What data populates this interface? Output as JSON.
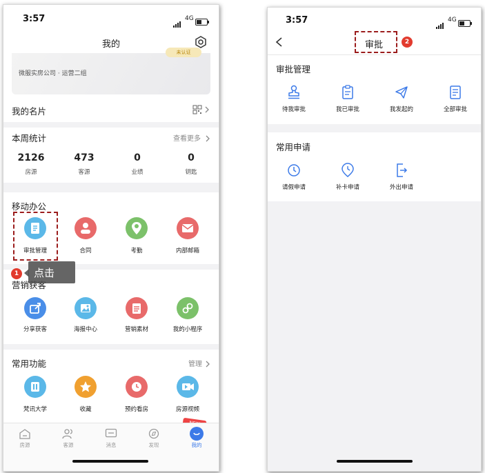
{
  "left": {
    "status": {
      "time": "3:57",
      "network": "4G"
    },
    "header": {
      "title": "我的"
    },
    "profile": {
      "badge": "未认证",
      "company": "微服实房公司 · 运营二组"
    },
    "business_card": {
      "label": "我的名片"
    },
    "weekly": {
      "title": "本周统计",
      "more": "查看更多",
      "stats": [
        {
          "value": "2126",
          "label": "房源"
        },
        {
          "value": "473",
          "label": "客源"
        },
        {
          "value": "0",
          "label": "业绩"
        },
        {
          "value": "0",
          "label": "钥匙"
        }
      ]
    },
    "mobile_office": {
      "title": "移动办公",
      "items": [
        {
          "label": "审批管理",
          "icon": "approval-doc-icon",
          "color": "#5bb8e8"
        },
        {
          "label": "合同",
          "icon": "person-contract-icon",
          "color": "#e86a6a"
        },
        {
          "label": "考勤",
          "icon": "location-pin-icon",
          "color": "#7cc16a"
        },
        {
          "label": "内部邮箱",
          "icon": "mail-icon",
          "color": "#e86a6a"
        }
      ]
    },
    "annotation": {
      "number": "1",
      "text": "点击"
    },
    "marketing": {
      "title": "营销获客",
      "items": [
        {
          "label": "分享获客",
          "icon": "share-icon",
          "color": "#4a8ee8"
        },
        {
          "label": "海报中心",
          "icon": "poster-icon",
          "color": "#5bb8e8"
        },
        {
          "label": "营销素材",
          "icon": "material-icon",
          "color": "#e86a6a"
        },
        {
          "label": "我的小程序",
          "icon": "mini-program-icon",
          "color": "#7cc16a"
        }
      ]
    },
    "common": {
      "title": "常用功能",
      "manage": "管理",
      "items": [
        {
          "label": "梵讯大学",
          "icon": "university-icon",
          "color": "#5bb8e8"
        },
        {
          "label": "收藏",
          "icon": "star-icon",
          "color": "#f0a030"
        },
        {
          "label": "预约看房",
          "icon": "clock-icon",
          "color": "#e86a6a"
        },
        {
          "label": "房源视频",
          "icon": "video-icon",
          "color": "#5bb8e8"
        }
      ]
    },
    "new_badge": "NEW",
    "tabbar": [
      {
        "label": "房源",
        "icon": "house-icon"
      },
      {
        "label": "客源",
        "icon": "people-icon"
      },
      {
        "label": "消息",
        "icon": "message-icon"
      },
      {
        "label": "发现",
        "icon": "compass-icon"
      },
      {
        "label": "我的",
        "icon": "me-icon",
        "active": true
      }
    ],
    "active_color": "#3c7ae8"
  },
  "right": {
    "status": {
      "time": "3:57",
      "network": "4G"
    },
    "header": {
      "title": "审批"
    },
    "annotation": {
      "number": "2"
    },
    "approval_mgmt": {
      "title": "审批管理",
      "items": [
        {
          "label": "待我审批",
          "icon": "stamp-icon"
        },
        {
          "label": "我已审批",
          "icon": "clipboard-icon"
        },
        {
          "label": "我发起的",
          "icon": "paper-plane-icon"
        },
        {
          "label": "全部审批",
          "icon": "document-list-icon"
        }
      ]
    },
    "common_apply": {
      "title": "常用申请",
      "items": [
        {
          "label": "请假申请",
          "icon": "leave-clock-icon"
        },
        {
          "label": "补卡申请",
          "icon": "punch-clock-icon"
        },
        {
          "label": "外出申请",
          "icon": "go-out-icon"
        }
      ]
    },
    "icon_color": "#3c7ae8"
  }
}
